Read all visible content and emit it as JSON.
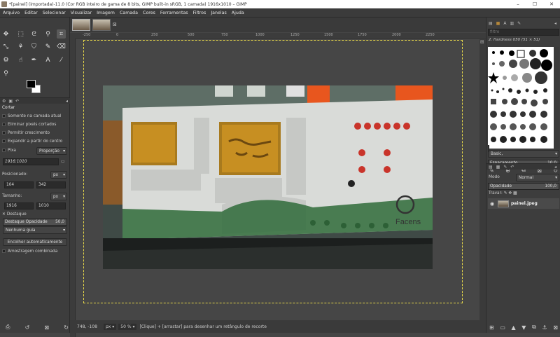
{
  "titlebar": {
    "title": "*[painel] (importada)-11.0 (Cor RGB inteiro de gama de 8 bits, GIMP built-in sRGB, 1 camada) 1916x1010 – GIMP",
    "minimize": "–",
    "maximize": "☐",
    "close": "✕"
  },
  "menu": [
    "Arquivo",
    "Editar",
    "Selecionar",
    "Visualizar",
    "Imagem",
    "Camada",
    "Cores",
    "Ferramentas",
    "Filtros",
    "Janelas",
    "Ajuda"
  ],
  "tool_options": {
    "header": "Cortar",
    "only_current_layer": "Somente na camada atual",
    "delete_cropped": "Eliminar pixels cortados",
    "allow_growing": "Permitir crescimento",
    "expand_center": "Expandir a partir do centro",
    "fixed_label": "Pixa",
    "fixed_mode": "Proporção",
    "aspect_value": "1916:1010",
    "position_label": "Posicionado:",
    "position_unit": "px",
    "pos_x": "104",
    "pos_y": "342",
    "size_label": "Tamanho:",
    "size_unit": "px",
    "size_w": "1916",
    "size_h": "1010",
    "highlight_label": "Destaque",
    "highlight_opacity_label": "Destaque Opacidade",
    "highlight_opacity_value": "50,0",
    "guides": "Nenhuma guia",
    "autoshrink": "Encolher automaticamente",
    "merged": "Amostragem combinada"
  },
  "status": {
    "coords": "748, -108",
    "unit": "px",
    "zoom": "50 %",
    "message": "[Clique] + [arrastar] para desenhar um retângulo de recorte"
  },
  "brushes": {
    "filter_placeholder": "filtro",
    "current_brush": "2. Hardness 050 (51 × 51)",
    "preset": "Basic,",
    "spacing_label": "Espaçamento",
    "spacing_value": "10,0"
  },
  "layers": {
    "mode_label": "Modo",
    "mode_value": "Normal",
    "opacity_label": "Opacidade",
    "opacity_value": "100,0",
    "lock_label": "Travar:",
    "layer_name": "painel.jpeg"
  },
  "photo": {
    "brand": "Facens"
  },
  "ruler_ticks": [
    "-250",
    "0",
    "250",
    "500",
    "750",
    "1000",
    "1250",
    "1500",
    "1750",
    "2000",
    "2250"
  ],
  "colors": {
    "accent": "#e7d84a",
    "panel_bg": "#3d3d3d",
    "canvas_bg": "#454545"
  }
}
